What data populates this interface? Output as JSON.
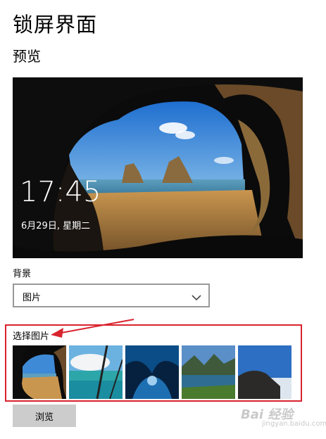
{
  "page": {
    "title": "锁屏界面"
  },
  "preview": {
    "heading": "预览",
    "time": "17:45",
    "date": "6月29日, 星期二"
  },
  "background": {
    "label": "背景",
    "selected": "图片"
  },
  "choose_picture": {
    "label": "选择图片",
    "thumbnails": [
      "sea-cave",
      "ocean-clouds",
      "ice-cave",
      "mountain-lake",
      "coast-cliff"
    ]
  },
  "browse_label": "浏览",
  "watermark": {
    "text": "Bai 经验",
    "sub": "jingyan.baidu.com"
  },
  "colors": {
    "highlight": "#d9232e",
    "button_bg": "#cccccc",
    "dropdown_border": "#999999"
  }
}
